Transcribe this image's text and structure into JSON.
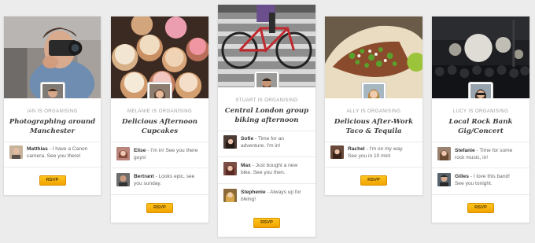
{
  "cards": [
    {
      "organiser": "IAN IS ORGANISING",
      "title_lines": [
        "Photographing around",
        "Manchester"
      ],
      "comments": [
        {
          "name": "Matthias",
          "line1": " - I have a Canon",
          "line2": "camera. See you there!"
        }
      ],
      "rsvp": "RSVP"
    },
    {
      "organiser": "MELANIE IS ORGANISING",
      "title_lines": [
        "Delicious Afternoon",
        "Cupcakes"
      ],
      "comments": [
        {
          "name": "Elise",
          "line1": " - I'm in! See you there",
          "line2": "guys!"
        },
        {
          "name": "Bertrant",
          "line1": " - Looks epic, see",
          "line2": "you sunday."
        }
      ],
      "rsvp": "RSVP"
    },
    {
      "organiser": "STUART IS ORGANISING",
      "title_lines": [
        "Central London group",
        "biking afternoon"
      ],
      "comments": [
        {
          "name": "Sofie",
          "line1": " - Time for an",
          "line2": "adventure. I'm in!"
        },
        {
          "name": "Max",
          "line1": " - Just bought a new",
          "line2": "bike. See you then."
        },
        {
          "name": "Stephenie",
          "line1": " - Always up for",
          "line2": "biking!"
        }
      ],
      "rsvp": "RSVP"
    },
    {
      "organiser": "ALLY IS ORGANISING",
      "title_lines": [
        "Delicious After-Work",
        "Taco & Tequila"
      ],
      "comments": [
        {
          "name": "Rachel",
          "line1": " - I'm on my way.",
          "line2": "See you in 10 min!"
        }
      ],
      "rsvp": "RSVP"
    },
    {
      "organiser": "LUCY IS ORGANISING",
      "title_lines": [
        "Local Rock Bank",
        "Gig/Concert"
      ],
      "comments": [
        {
          "name": "Stefanie",
          "line1": " - Time for some",
          "line2": "rock music, in!"
        },
        {
          "name": "Gilles",
          "line1": " - I love this band!",
          "line2": "See you tonight."
        }
      ],
      "rsvp": "RSVP"
    }
  ],
  "colors": {
    "background": "#ececec",
    "card": "#ffffff",
    "rsvp_button": "#f7b500",
    "organiser_text": "#9a9a9a"
  }
}
